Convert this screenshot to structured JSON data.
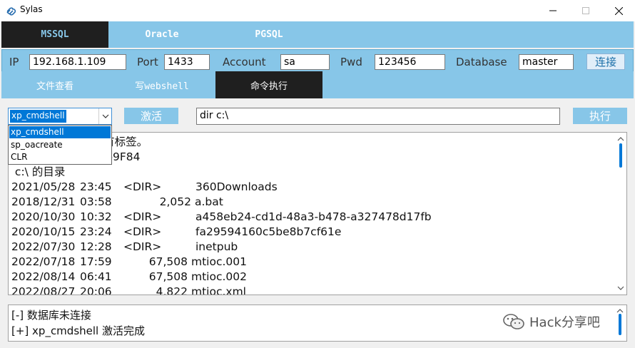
{
  "window": {
    "title": "Sylas",
    "minimize_icon": "minimize-icon",
    "maximize_icon": "maximize-icon",
    "close_icon": "close-icon"
  },
  "db_tabs": [
    {
      "label": "MSSQL",
      "active": true
    },
    {
      "label": "Oracle",
      "active": false
    },
    {
      "label": "PGSQL",
      "active": false
    }
  ],
  "connection": {
    "ip_label": "IP",
    "ip_value": "192.168.1.109",
    "port_label": "Port",
    "port_value": "1433",
    "account_label": "Account",
    "account_value": "sa",
    "pwd_label": "Pwd",
    "pwd_value": "123456",
    "database_label": "Database",
    "database_value": "master",
    "connect_label": "连接"
  },
  "func_tabs": [
    {
      "label": "文件查看",
      "active": false
    },
    {
      "label": "写webshell",
      "active": false
    },
    {
      "label": "命令执行",
      "active": true
    }
  ],
  "command": {
    "method_selected": "xp_cmdshell",
    "method_options": [
      "xp_cmdshell",
      "sp_oacreate",
      "CLR"
    ],
    "activate_label": "激活",
    "cmd_value": "dir c:\\",
    "execute_label": "执行"
  },
  "output": {
    "lines": [
      {
        "text": "驱动器 C 中的卷没有标签。"
      },
      {
        "text": "卷的序列号是 1F44-9F84"
      },
      {
        "text": " c:\\ 的目录"
      },
      {
        "date": "2021/05/28",
        "time": "23:45",
        "dir": "<DIR>",
        "size": "",
        "name": "360Downloads"
      },
      {
        "date": "2018/12/31",
        "time": "03:58",
        "dir": "",
        "size": "2,052",
        "name": "a.bat"
      },
      {
        "date": "2020/10/30",
        "time": "10:32",
        "dir": "<DIR>",
        "size": "",
        "name": "a458eb24-cd1d-48a3-b478-a327478d17fb"
      },
      {
        "date": "2020/10/15",
        "time": "23:24",
        "dir": "<DIR>",
        "size": "",
        "name": "fa29594160c5be8b7cf61e"
      },
      {
        "date": "2022/07/30",
        "time": "12:28",
        "dir": "<DIR>",
        "size": "",
        "name": "inetpub"
      },
      {
        "date": "2022/07/18",
        "time": "17:59",
        "dir": "",
        "size": "67,508",
        "name": "mtioc.001"
      },
      {
        "date": "2022/08/14",
        "time": "06:41",
        "dir": "",
        "size": "67,508",
        "name": "mtioc.002"
      },
      {
        "date": "2022/08/27",
        "time": "20:06",
        "dir": "",
        "size": "4,822",
        "name": "mtioc.xml"
      }
    ]
  },
  "status": {
    "lines": [
      "[-] 数据库未连接",
      "[+] xp_cmdshell 激活完成"
    ]
  },
  "watermark": {
    "text": "Hack分享吧",
    "icon": "wechat-icon"
  },
  "colors": {
    "tab_bar": "#87c6e8",
    "active_tab": "#1f1f1f",
    "selection": "#0078d7"
  }
}
